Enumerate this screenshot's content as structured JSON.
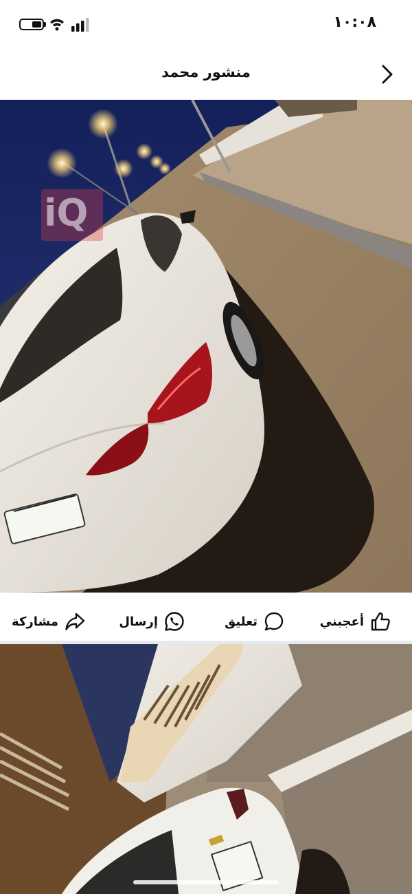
{
  "status_bar": {
    "time": "١٠:٠٨",
    "battery_icon": "battery-icon",
    "wifi_icon": "wifi-icon",
    "signal_icon": "cellular-signal-icon"
  },
  "header": {
    "title": "منشور محمد",
    "back_icon": "chevron-right-icon"
  },
  "post": {
    "watermark": "iQ",
    "photos": [
      {
        "name": "car-rear-night-photo"
      },
      {
        "name": "car-rear-building-photo"
      }
    ],
    "actions": {
      "like_label": "أعجبني",
      "comment_label": "تعليق",
      "send_label": "إرسال",
      "share_label": "مشاركة"
    }
  },
  "colors": {
    "text": "#111111",
    "divider": "#e6e9ee",
    "sky_night": "#1b2a6b"
  }
}
